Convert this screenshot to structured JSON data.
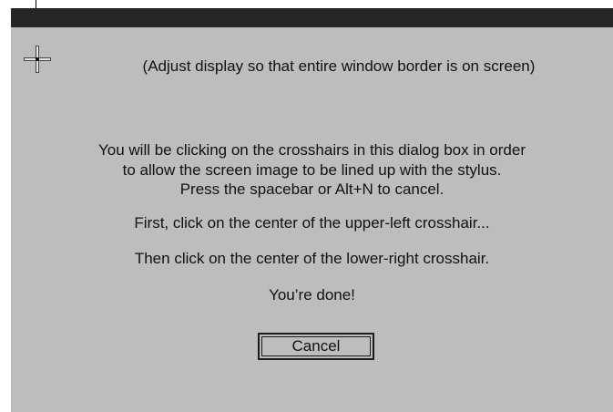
{
  "dialog": {
    "hint": "(Adjust display so that entire window border is on screen)",
    "instructions": [
      "You will be clicking on the crosshairs in this dialog box in order",
      "to allow the screen image to be lined up with the stylus.",
      "Press the spacebar or Alt+N to cancel."
    ],
    "step1": "First, click on the center of the upper-left crosshair...",
    "step2": "Then click on the center of the lower-right crosshair.",
    "done": "You’re done!",
    "cancel_label": "Cancel"
  },
  "colors": {
    "title_bar": "#262626",
    "dialog_bg": "#bdbdbd",
    "text": "#111111"
  },
  "icons": {
    "crosshair": "crosshair-icon"
  }
}
